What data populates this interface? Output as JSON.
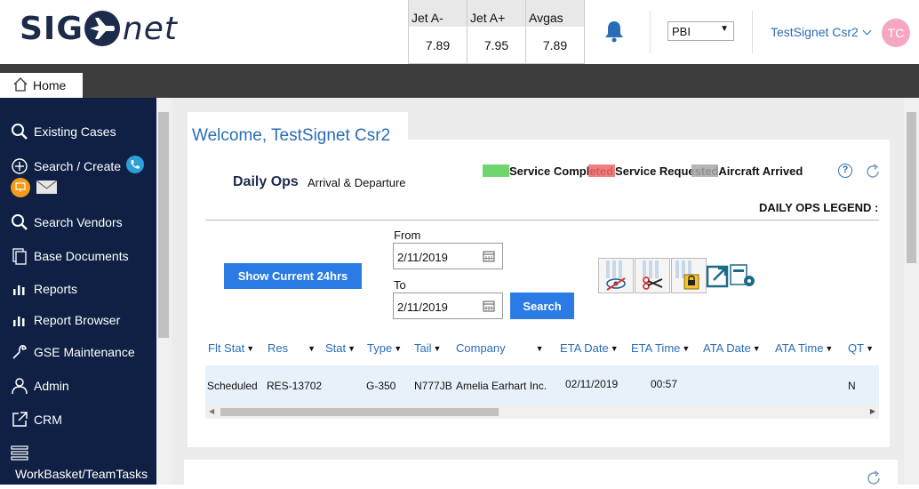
{
  "header": {
    "logo_left": "SIG",
    "logo_right": "net",
    "fuel": [
      {
        "label": "Jet A-",
        "price": "7.89"
      },
      {
        "label": "Jet A+",
        "price": "7.95"
      },
      {
        "label": "Avgas",
        "price": "7.89"
      }
    ],
    "airport": "PBI",
    "user_name": "TestSignet Csr2",
    "avatar_initials": "TC"
  },
  "tabs": {
    "home": "Home"
  },
  "sidebar": {
    "items": [
      {
        "label": "Existing Cases",
        "icon": "search-icon"
      },
      {
        "label": "Search / Create",
        "icon": "plus-circle-icon"
      },
      {
        "label": "Search Vendors",
        "icon": "search-icon"
      },
      {
        "label": "Base Documents",
        "icon": "documents-icon"
      },
      {
        "label": "Reports",
        "icon": "bar-chart-icon"
      },
      {
        "label": "Report Browser",
        "icon": "bar-chart-icon"
      },
      {
        "label": "GSE Maintenance",
        "icon": "wrench-icon"
      },
      {
        "label": "Admin",
        "icon": "person-icon"
      },
      {
        "label": "CRM",
        "icon": "external-link-icon"
      },
      {
        "label": "WorkBasket/TeamTasks",
        "icon": "list-icon"
      }
    ]
  },
  "main": {
    "welcome": "Welcome, TestSignet Csr2",
    "daily_ops": "Daily Ops",
    "arrival_departure": "Arrival & Departure",
    "legend": [
      {
        "label": "Service Completed",
        "color": "#6fd66f"
      },
      {
        "label": "Service Requested",
        "color": "#f06a6a"
      },
      {
        "label": "Aircraft Arrived",
        "color": "#a8a8a8"
      }
    ],
    "legend_title": "DAILY OPS LEGEND :",
    "show_current_label": "Show Current 24hrs",
    "from_label": "From",
    "from_value": "2/11/2019",
    "to_label": "To",
    "to_value": "2/11/2019",
    "search_label": "Search",
    "accent": "#2a7be4",
    "table": {
      "columns": [
        "Flt Stat",
        "Res",
        "Stat",
        "Type",
        "Tail",
        "Company",
        "ETA Date",
        "ETA Time",
        "ATA Date",
        "ATA Time",
        "QT"
      ],
      "rows": [
        {
          "flt_stat": "Scheduled",
          "res": "RES-13702",
          "type": "G-350",
          "tail": "N777JB",
          "company": "Amelia Earhart Inc.",
          "eta_date": "02/11/2019",
          "eta_time": "00:57",
          "qt": "N"
        }
      ]
    }
  }
}
